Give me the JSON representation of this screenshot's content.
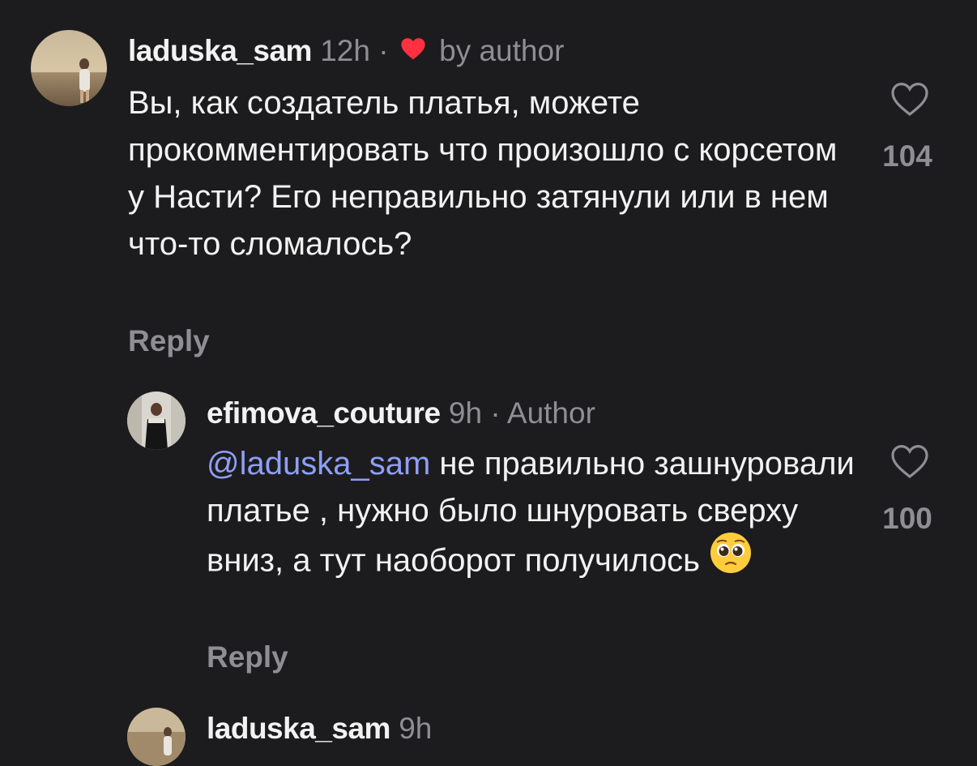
{
  "comments": [
    {
      "username": "laduska_sam",
      "time": "12h",
      "separator": "·",
      "liked_by": "by author",
      "text": "Вы, как создатель платья, можете прокомментировать что произошло с корсетом у Насти? Его неправильно затянули или в нем что-то сломалось?",
      "reply_label": "Reply",
      "likes": "104"
    },
    {
      "username": "efimova_couture",
      "time": "9h",
      "separator": "·",
      "badge": "Author",
      "mention": "@laduska_sam",
      "text": " не правильно зашнуровали платье , нужно было шнуровать сверху вниз, а тут наоборот получилось ",
      "reply_label": "Reply",
      "likes": "100"
    },
    {
      "username": "laduska_sam",
      "time": "9h"
    }
  ],
  "icons": {
    "like": "heart-outline-icon",
    "liked_by_author": "heart-filled-icon",
    "emoji": "pleading-face-emoji"
  },
  "colors": {
    "background": "#1c1c1e",
    "mention": "#8e9ff5",
    "heart": "#ff3040",
    "muted": "#8e8e93"
  }
}
